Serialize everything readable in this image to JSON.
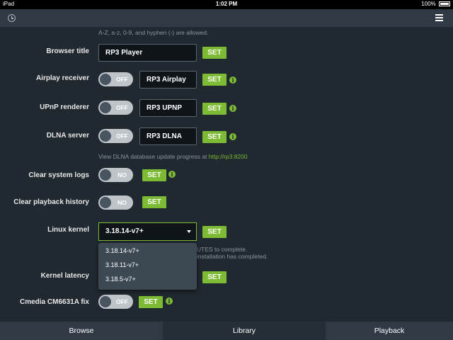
{
  "status_bar": {
    "device": "iPad",
    "time": "1:02 PM",
    "battery": "100%"
  },
  "top_bar": {
    "left_icon": "clock-icon",
    "right_icon": "menu-icon"
  },
  "hostname_note": "A-Z, a-z, 0-9, and hyphen (-) are allowed.",
  "browser_title": {
    "label": "Browser title",
    "value": "RP3 Player",
    "set_label": "SET"
  },
  "airplay": {
    "label": "Airplay receiver",
    "toggle": "OFF",
    "value": "RP3 Airplay",
    "set_label": "SET",
    "info": "i"
  },
  "upnp": {
    "label": "UPnP renderer",
    "toggle": "OFF",
    "value": "RP3 UPNP",
    "set_label": "SET",
    "info": "i"
  },
  "dlna": {
    "label": "DLNA server",
    "toggle": "OFF",
    "value": "RP3 DLNA",
    "set_label": "SET",
    "info": "i",
    "note_text": "View DLNA database update progress at ",
    "note_link": "http://rp3:8200"
  },
  "clear_logs": {
    "label": "Clear system logs",
    "toggle": "NO",
    "set_label": "SET",
    "info": "i"
  },
  "clear_history": {
    "label": "Clear playback history",
    "toggle": "NO",
    "set_label": "SET"
  },
  "linux_kernel": {
    "label": "Linux kernel",
    "selected": "3.18.14-v7+",
    "set_label": "SET",
    "note_line1": "UTES to complete.",
    "note_line2": "installation has completed.",
    "options": [
      "3.18.14-v7+",
      "3.18.11-v7+",
      "3.18.5-v7+"
    ]
  },
  "kernel_latency": {
    "label": "Kernel latency",
    "set_label": "SET"
  },
  "cmedia": {
    "label": "Cmedia CM6631A fix",
    "toggle": "OFF",
    "set_label": "SET",
    "info": "i"
  },
  "tabs": [
    {
      "label": "Browse"
    },
    {
      "label": "Library"
    },
    {
      "label": "Playback"
    }
  ],
  "colors": {
    "accent": "#7dbb34",
    "background": "#202830",
    "bar": "#2f3a45"
  }
}
